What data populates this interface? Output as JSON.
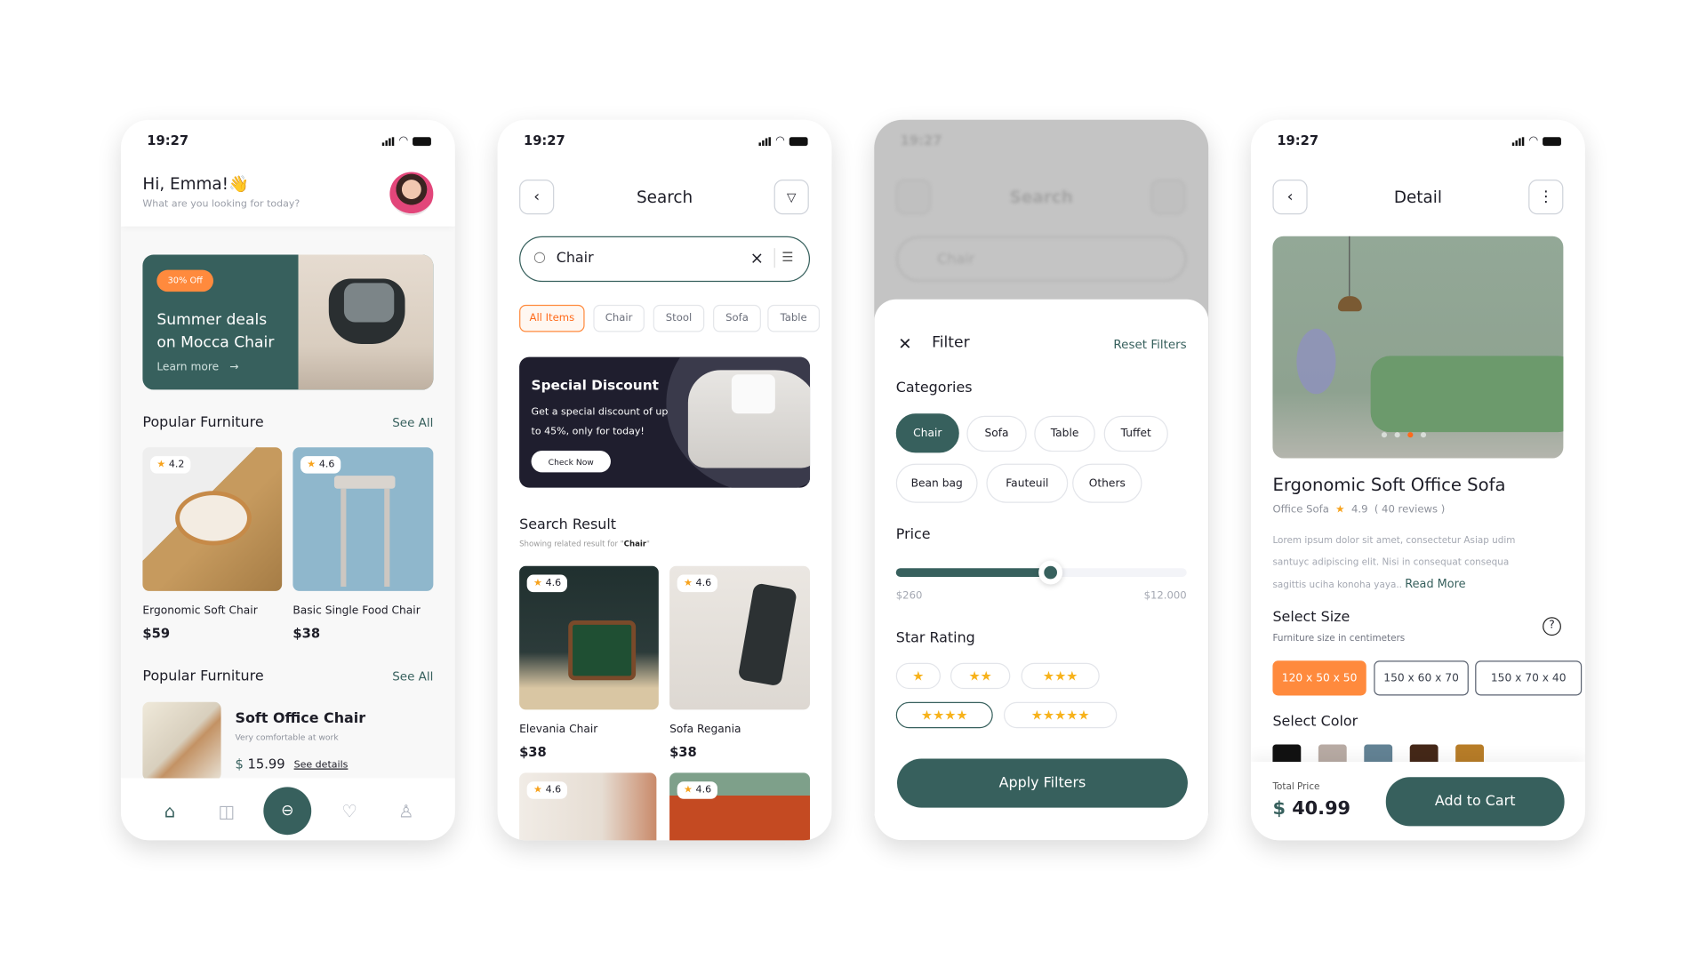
{
  "colors": {
    "primary": "#37605d",
    "accent": "#ff8a3d",
    "dark_banner": "#1f1e2e",
    "star": "#f7a21b"
  },
  "status_time": "19:27",
  "home": {
    "greeting": "Hi, Emma!👋",
    "subtitle": "What are you looking for today?",
    "banner": {
      "badge": "30% Off",
      "title_line1": "Summer deals",
      "title_line2": "on Mocca Chair",
      "link": "Learn more",
      "arrow": "→"
    },
    "section1": {
      "title": "Popular Furniture",
      "see_all": "See All"
    },
    "products": [
      {
        "name": "Ergonomic Soft  Chair",
        "price": "$59",
        "rating": "4.2"
      },
      {
        "name": "Basic Single Food Chair",
        "price": "$38",
        "rating": "4.6"
      }
    ],
    "section2": {
      "title": "Popular Furniture",
      "see_all": "See All"
    },
    "list_item": {
      "title": "Soft Office Chair",
      "subtitle": "Very comfortable at work",
      "currency": "$",
      "price": "15.99",
      "link": "See details"
    },
    "nav": [
      "home-icon",
      "bag-icon",
      "scan-icon",
      "heart-icon",
      "profile-icon"
    ]
  },
  "search": {
    "title": "Search",
    "query": "Chair",
    "clear": "×",
    "chips": [
      {
        "label": "All Items",
        "active": true
      },
      {
        "label": "Chair"
      },
      {
        "label": "Stool"
      },
      {
        "label": "Sofa"
      },
      {
        "label": "Table"
      }
    ],
    "banner": {
      "title": "Special Discount",
      "line1": "Get a special discount of up",
      "line2": "to 45%, only for today!",
      "button": "Check Now"
    },
    "result_title": "Search Result",
    "result_prefix": "Showing related result for \"",
    "result_term": "Chair",
    "result_suffix": "\"",
    "results": [
      {
        "name": "Elevania Chair",
        "price": "$38",
        "rating": "4.6"
      },
      {
        "name": "Sofa Regania",
        "price": "$38",
        "rating": "4.6"
      },
      {
        "rating": "4.6"
      },
      {
        "rating": "4.6"
      }
    ]
  },
  "filter": {
    "bg_title": "Search",
    "bg_query": "Chair",
    "title": "Filter",
    "reset": "Reset Filters",
    "close": "✕",
    "categories_title": "Categories",
    "categories": [
      {
        "label": "Chair",
        "selected": true
      },
      {
        "label": "Sofa"
      },
      {
        "label": "Table"
      },
      {
        "label": "Tuffet"
      },
      {
        "label": "Bean bag"
      },
      {
        "label": "Fauteuil"
      },
      {
        "label": "Others"
      }
    ],
    "price_title": "Price",
    "price_min": "$260",
    "price_max": "$12.000",
    "slider_fraction": 0.53,
    "star_title": "Star Rating",
    "star_options": [
      1,
      2,
      3,
      4,
      5
    ],
    "star_selected": 4,
    "apply": "Apply Filters"
  },
  "detail": {
    "title": "Detail",
    "image_dots": 4,
    "active_dot": 3,
    "product_name": "Ergonomic Soft Office Sofa",
    "category": "Office Sofa",
    "rating": "4.9",
    "reviews": "( 40 reviews )",
    "desc1": "Lorem ipsum dolor sit amet, consectetur Asiap udim",
    "desc2": "santuyc adipiscing elit. Nisi in consequat consequa",
    "desc3": "sagittis uciha konoha yaya..",
    "read_more": "Read More",
    "size_title": "Select Size",
    "size_sub": "Furniture size in centimeters",
    "sizes": [
      {
        "label": "120 x 50 x 50",
        "selected": true
      },
      {
        "label": "150 x 60 x 70"
      },
      {
        "label": "150 x 70 x 40"
      }
    ],
    "color_title": "Select Color",
    "colors": [
      "#121212",
      "#b8aba4",
      "#638395",
      "#452818",
      "#b87d28"
    ],
    "total_label": "Total Price",
    "currency": "$",
    "total": "40.99",
    "cart": "Add to Cart"
  }
}
